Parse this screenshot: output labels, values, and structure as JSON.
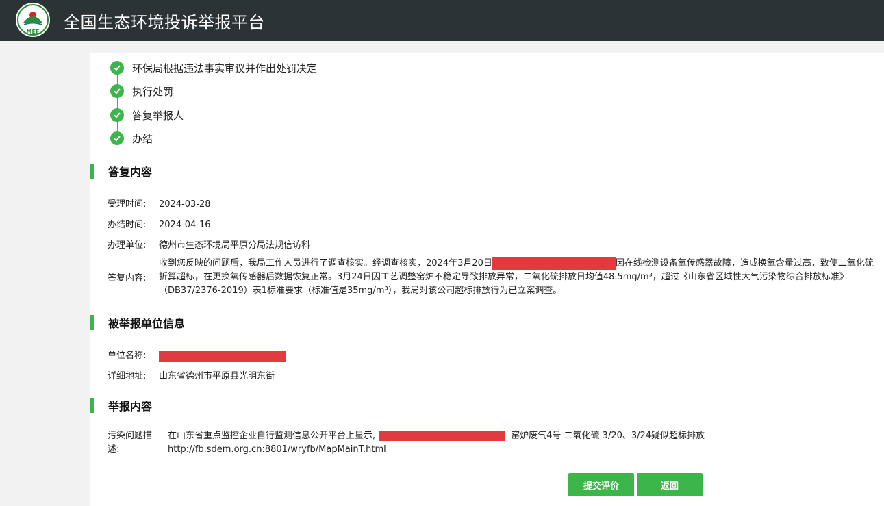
{
  "header": {
    "title": "全国生态环境投诉举报平台",
    "logo_text": "MEE"
  },
  "timeline": [
    {
      "label": "环保局根据违法事实审议并作出处罚决定"
    },
    {
      "label": "执行处罚"
    },
    {
      "label": "答复举报人"
    },
    {
      "label": "办结"
    }
  ],
  "reply_section": {
    "title": "答复内容",
    "accept_time_label": "受理时间:",
    "accept_time": "2024-03-28",
    "finish_time_label": "办结时间:",
    "finish_time": "2024-04-16",
    "unit_label": "办理单位:",
    "unit": "德州市生态环境局平原分局法规信访科",
    "content_label": "答复内容:",
    "content_part1": "收到您反映的问题后，我局工作人员进行了调查核实。经调查核实，2024年3月20日",
    "content_part2": "因在线检测设备氧传感器故障，造成换氧含量过高，致使二氧化硫折算超标，在更换氧传感器后数据恢复正常。3月24日因工艺调整窑炉不稳定导致排放异常，二氧化硫排放日均值48.5mg/m³，超过《山东省区域性大气污染物综合排放标准》（DB37/2376-2019）表1标准要求（标准值是35mg/m³），我局对该公司超标排放行为已立案调查。"
  },
  "reported_unit_section": {
    "title": "被举报单位信息",
    "name_label": "单位名称:",
    "address_label": "详细地址:",
    "address": "山东省德州市平原县光明东街"
  },
  "complaint_section": {
    "title": "举报内容",
    "desc_label": "污染问题描述:",
    "desc_part1": "在山东省重点监控企业自行监测信息公开平台上显示,",
    "desc_part2": "窑炉废气4号 二氧化硫 3/20、3/24疑似超标排放",
    "desc_url": "http://fb.sdem.org.cn:8801/wryfb/MapMainT.html"
  },
  "buttons": {
    "submit_review": "提交评价",
    "back": "返回"
  },
  "colors": {
    "header_bg": "#2b3337",
    "accent_green": "#3cb54a",
    "redaction": "#e23b3f"
  }
}
